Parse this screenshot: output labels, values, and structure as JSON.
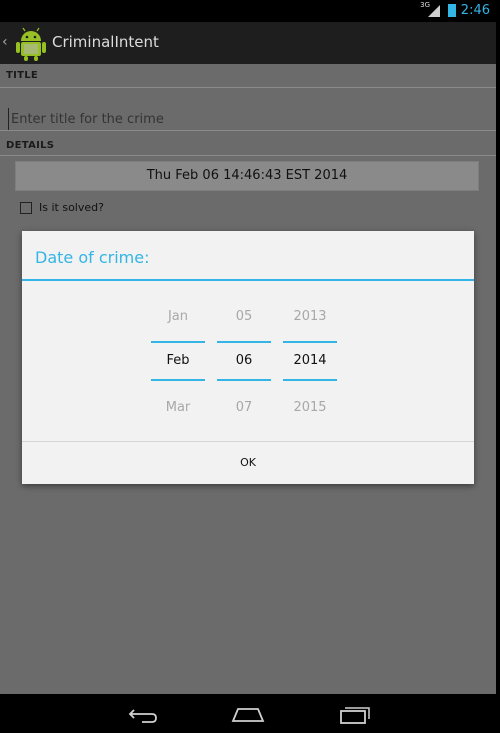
{
  "status_bar": {
    "network": "3G",
    "time": "2:46",
    "accent": "#33b5e5"
  },
  "action_bar": {
    "title": "CriminalIntent"
  },
  "form": {
    "title_section": "TITLE",
    "title_placeholder": "Enter title for the crime",
    "details_section": "DETAILS",
    "date_button": "Thu Feb 06 14:46:43 EST 2014",
    "solved_label": "Is it solved?",
    "solved_checked": false
  },
  "dialog": {
    "title": "Date of crime:",
    "month": {
      "prev": "Jan",
      "selected": "Feb",
      "next": "Mar"
    },
    "day": {
      "prev": "05",
      "selected": "06",
      "next": "07"
    },
    "year": {
      "prev": "2013",
      "selected": "2014",
      "next": "2015"
    },
    "ok_label": "OK"
  },
  "nav_bar": {
    "icons": [
      "back-icon",
      "home-icon",
      "recent-apps-icon"
    ]
  }
}
